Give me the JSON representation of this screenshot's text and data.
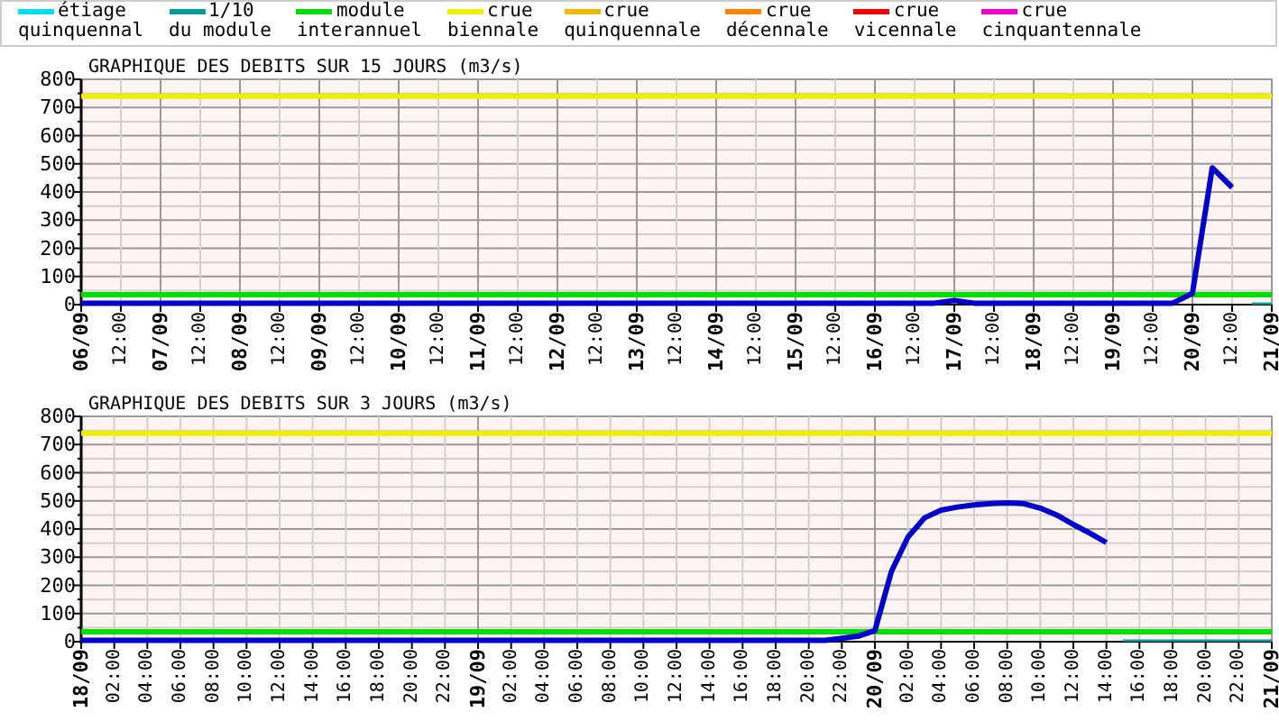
{
  "legend": [
    {
      "lines": [
        "étiage",
        "quinquennal"
      ],
      "color": "#00e0e8"
    },
    {
      "lines": [
        "1/10",
        "du module"
      ],
      "color": "#009a9a"
    },
    {
      "lines": [
        "module",
        "interannuel"
      ],
      "color": "#00dd00"
    },
    {
      "lines": [
        "crue",
        "biennale"
      ],
      "color": "#eeee00"
    },
    {
      "lines": [
        "crue",
        "quinquennale"
      ],
      "color": "#eebb00"
    },
    {
      "lines": [
        "crue",
        "décennale"
      ],
      "color": "#ff8800"
    },
    {
      "lines": [
        "crue",
        "vicennale"
      ],
      "color": "#ee0000"
    },
    {
      "lines": [
        "crue",
        "cinquantennale"
      ],
      "color": "#ee00cc"
    }
  ],
  "charts": [
    {
      "chart_data": {
        "type": "line",
        "title": "GRAPHIQUE DES DEBITS SUR 15 JOURS (m3/s)",
        "ylim": [
          0,
          800
        ],
        "yticks": [
          0,
          100,
          200,
          300,
          400,
          500,
          600,
          700,
          800
        ],
        "grid": true,
        "categories": [
          "06/09",
          null,
          "12:00",
          null,
          "07/09",
          null,
          "12:00",
          null,
          "08/09",
          null,
          "12:00",
          null,
          "09/09",
          null,
          "12:00",
          null,
          "10/09",
          null,
          "12:00",
          null,
          "11/09",
          null,
          "12:00",
          null,
          "12/09",
          null,
          "12:00",
          null,
          "13/09",
          null,
          "12:00",
          null,
          "14/09",
          null,
          "12:00",
          null,
          "15/09",
          null,
          "12:00",
          null,
          "16/09",
          null,
          "12:00",
          null,
          "17/09",
          null,
          "12:00",
          null,
          "18/09",
          null,
          "12:00",
          null,
          "19/09",
          null,
          "12:00",
          null,
          "20/09",
          null,
          "12:00",
          null,
          "21/09"
        ],
        "series": [
          {
            "color": "#009a9a",
            "values": [
              null,
              null,
              null,
              null,
              null,
              null,
              null,
              null,
              null,
              null,
              null,
              null,
              null,
              null,
              null,
              null,
              null,
              null,
              null,
              null,
              null,
              null,
              null,
              null,
              null,
              null,
              null,
              null,
              null,
              null,
              null,
              null,
              null,
              null,
              null,
              null,
              null,
              null,
              null,
              null,
              null,
              null,
              null,
              null,
              null,
              null,
              null,
              null,
              null,
              null,
              null,
              null,
              null,
              null,
              null,
              null,
              null,
              null,
              null,
              4,
              4
            ]
          },
          {
            "color": "#00dd00",
            "values": [
              35,
              35,
              35,
              35,
              35,
              35,
              35,
              35,
              35,
              35,
              35,
              35,
              35,
              35,
              35,
              35,
              35,
              35,
              35,
              35,
              35,
              35,
              35,
              35,
              35,
              35,
              35,
              35,
              35,
              35,
              35,
              35,
              35,
              35,
              35,
              35,
              35,
              35,
              35,
              35,
              35,
              35,
              35,
              35,
              35,
              35,
              35,
              35,
              35,
              35,
              35,
              35,
              35,
              35,
              35,
              35,
              35,
              35,
              35,
              35,
              35
            ]
          },
          {
            "color": "#eeee00",
            "values": [
              740,
              740,
              740,
              740,
              740,
              740,
              740,
              740,
              740,
              740,
              740,
              740,
              740,
              740,
              740,
              740,
              740,
              740,
              740,
              740,
              740,
              740,
              740,
              740,
              740,
              740,
              740,
              740,
              740,
              740,
              740,
              740,
              740,
              740,
              740,
              740,
              740,
              740,
              740,
              740,
              740,
              740,
              740,
              740,
              740,
              740,
              740,
              740,
              740,
              740,
              740,
              740,
              740,
              740,
              740,
              740,
              740,
              740,
              740,
              740,
              740
            ]
          },
          {
            "color": "#0000cc",
            "values": [
              5,
              5,
              5,
              5,
              5,
              5,
              5,
              5,
              5,
              5,
              5,
              5,
              5,
              5,
              5,
              5,
              5,
              5,
              5,
              5,
              5,
              5,
              5,
              5,
              5,
              5,
              5,
              5,
              5,
              5,
              5,
              5,
              5,
              5,
              5,
              5,
              5,
              5,
              5,
              5,
              5,
              5,
              5,
              5,
              15,
              5,
              5,
              5,
              5,
              5,
              5,
              5,
              5,
              5,
              5,
              5,
              40,
              486,
              416,
              null,
              null
            ]
          }
        ]
      }
    },
    {
      "chart_data": {
        "type": "line",
        "title": "GRAPHIQUE DES DEBITS SUR 3 JOURS (m3/s)",
        "ylim": [
          0,
          800
        ],
        "yticks": [
          0,
          100,
          200,
          300,
          400,
          500,
          600,
          700,
          800
        ],
        "grid": true,
        "categories": [
          "18/09",
          null,
          "02:00",
          null,
          "04:00",
          null,
          "06:00",
          null,
          "08:00",
          null,
          "10:00",
          null,
          "12:00",
          null,
          "14:00",
          null,
          "16:00",
          null,
          "18:00",
          null,
          "20:00",
          null,
          "22:00",
          null,
          "19/09",
          null,
          "02:00",
          null,
          "04:00",
          null,
          "06:00",
          null,
          "08:00",
          null,
          "10:00",
          null,
          "12:00",
          null,
          "14:00",
          null,
          "16:00",
          null,
          "18:00",
          null,
          "20:00",
          null,
          "22:00",
          null,
          "20/09",
          null,
          "02:00",
          null,
          "04:00",
          null,
          "06:00",
          null,
          "08:00",
          null,
          "10:00",
          null,
          "12:00",
          null,
          "14:00",
          null,
          "16:00",
          null,
          "18:00",
          null,
          "20:00",
          null,
          "22:00",
          null,
          "21/09"
        ],
        "series": [
          {
            "color": "#009a9a",
            "values": [
              null,
              null,
              null,
              null,
              null,
              null,
              null,
              null,
              null,
              null,
              null,
              null,
              null,
              null,
              null,
              null,
              null,
              null,
              null,
              null,
              null,
              null,
              null,
              null,
              null,
              null,
              null,
              null,
              null,
              null,
              null,
              null,
              null,
              null,
              null,
              null,
              null,
              null,
              null,
              null,
              null,
              null,
              null,
              null,
              null,
              null,
              null,
              null,
              null,
              null,
              null,
              null,
              null,
              null,
              null,
              null,
              null,
              null,
              null,
              null,
              null,
              null,
              null,
              4,
              4,
              4,
              4,
              4,
              4,
              4,
              4,
              4,
              4
            ]
          },
          {
            "color": "#00dd00",
            "values": [
              35,
              35,
              35,
              35,
              35,
              35,
              35,
              35,
              35,
              35,
              35,
              35,
              35,
              35,
              35,
              35,
              35,
              35,
              35,
              35,
              35,
              35,
              35,
              35,
              35,
              35,
              35,
              35,
              35,
              35,
              35,
              35,
              35,
              35,
              35,
              35,
              35,
              35,
              35,
              35,
              35,
              35,
              35,
              35,
              35,
              35,
              35,
              35,
              35,
              35,
              35,
              35,
              35,
              35,
              35,
              35,
              35,
              35,
              35,
              35,
              35,
              35,
              35,
              35,
              35,
              35,
              35,
              35,
              35,
              35,
              35,
              35,
              35
            ]
          },
          {
            "color": "#eeee00",
            "values": [
              740,
              740,
              740,
              740,
              740,
              740,
              740,
              740,
              740,
              740,
              740,
              740,
              740,
              740,
              740,
              740,
              740,
              740,
              740,
              740,
              740,
              740,
              740,
              740,
              740,
              740,
              740,
              740,
              740,
              740,
              740,
              740,
              740,
              740,
              740,
              740,
              740,
              740,
              740,
              740,
              740,
              740,
              740,
              740,
              740,
              740,
              740,
              740,
              740,
              740,
              740,
              740,
              740,
              740,
              740,
              740,
              740,
              740,
              740,
              740,
              740,
              740,
              740,
              740,
              740,
              740,
              740,
              740,
              740,
              740,
              740,
              740,
              740
            ]
          },
          {
            "color": "#0000cc",
            "values": [
              5,
              5,
              5,
              5,
              5,
              5,
              5,
              5,
              5,
              5,
              5,
              5,
              5,
              5,
              5,
              5,
              5,
              5,
              5,
              5,
              5,
              5,
              5,
              5,
              5,
              5,
              5,
              5,
              5,
              5,
              5,
              5,
              5,
              5,
              5,
              5,
              5,
              5,
              5,
              5,
              5,
              5,
              5,
              5,
              5,
              5,
              12,
              20,
              40,
              250,
              371,
              440,
              467,
              478,
              486,
              490,
              493,
              490,
              474,
              450,
              416,
              385,
              352,
              null,
              null,
              null,
              null,
              null,
              null,
              null,
              null,
              null,
              null
            ]
          }
        ]
      }
    }
  ]
}
